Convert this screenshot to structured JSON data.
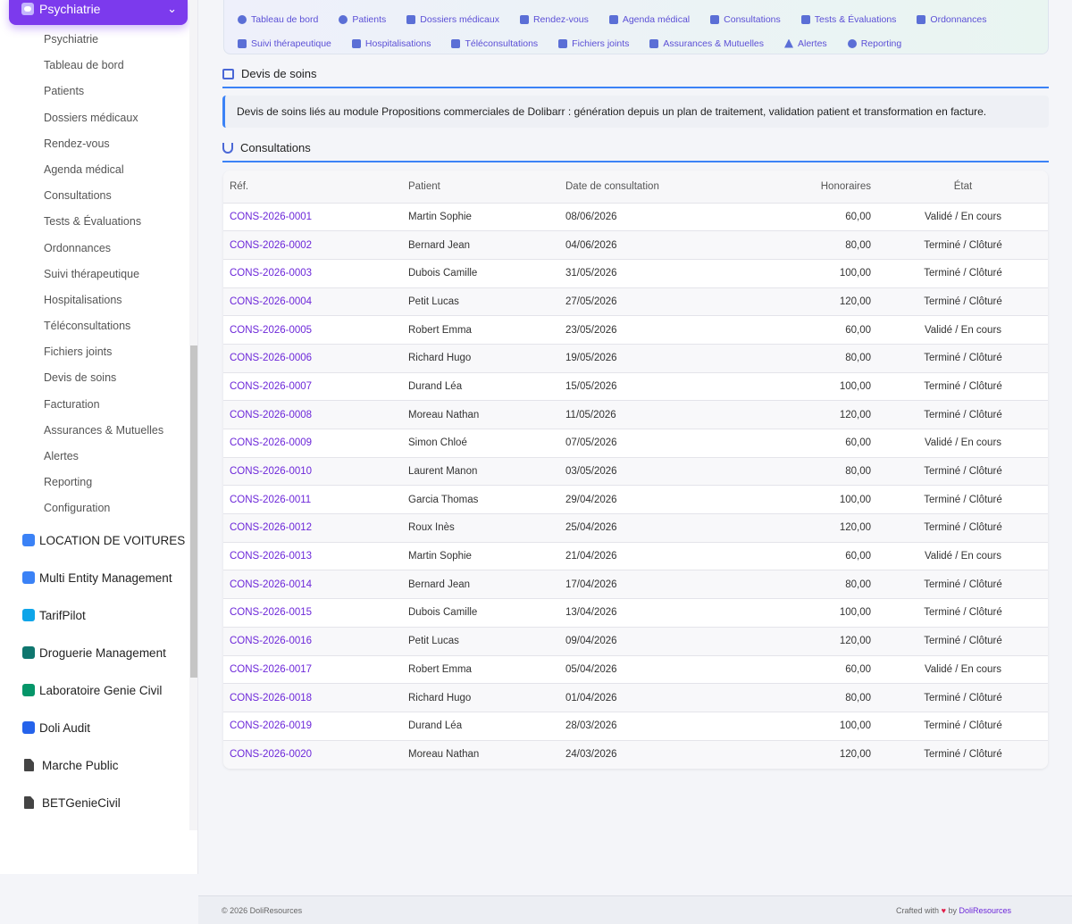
{
  "sidebar": {
    "active_title": "Psychiatrie",
    "sub_items": [
      "Psychiatrie",
      "Tableau de bord",
      "Patients",
      "Dossiers médicaux",
      "Rendez-vous",
      "Agenda médical",
      "Consultations",
      "Tests & Évaluations",
      "Ordonnances",
      "Suivi thérapeutique",
      "Hospitalisations",
      "Téléconsultations",
      "Fichiers joints",
      "Devis de soins",
      "Facturation",
      "Assurances & Mutuelles",
      "Alertes",
      "Reporting",
      "Configuration"
    ],
    "modules": [
      {
        "label": "LOCATION DE VOITURES",
        "color": "#3b82f6"
      },
      {
        "label": "Multi Entity Management",
        "color": "#3b82f6"
      },
      {
        "label": "TarifPilot",
        "color": "#0ea5e9"
      },
      {
        "label": "Droguerie Management",
        "color": "#0f766e"
      },
      {
        "label": "Laboratoire Genie Civil",
        "color": "#059669"
      },
      {
        "label": "Doli Audit",
        "color": "#2563eb"
      },
      {
        "label": "Marche Public",
        "color": "#444444"
      },
      {
        "label": "BETGenieCivil",
        "color": "#444444"
      }
    ]
  },
  "topnav": {
    "row1": [
      "Tableau de bord",
      "Patients",
      "Dossiers médicaux",
      "Rendez-vous",
      "Agenda médical",
      "Consultations",
      "Tests & Évaluations",
      "Ordonnances"
    ],
    "row2": [
      "Suivi thérapeutique",
      "Hospitalisations",
      "Téléconsultations",
      "Fichiers joints",
      "Assurances & Mutuelles",
      "Alertes",
      "Reporting"
    ]
  },
  "devis": {
    "title": "Devis de soins",
    "info": "Devis de soins liés au module Propositions commerciales de Dolibarr : génération depuis un plan de traitement, validation patient et transformation en facture."
  },
  "consultations": {
    "title": "Consultations",
    "headers": {
      "ref": "Réf.",
      "patient": "Patient",
      "date": "Date de consultation",
      "honoraires": "Honoraires",
      "etat": "État"
    },
    "rows": [
      [
        "CONS-2026-0001",
        "Martin Sophie",
        "08/06/2026",
        "60,00",
        "Validé / En cours"
      ],
      [
        "CONS-2026-0002",
        "Bernard Jean",
        "04/06/2026",
        "80,00",
        "Terminé / Clôturé"
      ],
      [
        "CONS-2026-0003",
        "Dubois Camille",
        "31/05/2026",
        "100,00",
        "Terminé / Clôturé"
      ],
      [
        "CONS-2026-0004",
        "Petit Lucas",
        "27/05/2026",
        "120,00",
        "Terminé / Clôturé"
      ],
      [
        "CONS-2026-0005",
        "Robert Emma",
        "23/05/2026",
        "60,00",
        "Validé / En cours"
      ],
      [
        "CONS-2026-0006",
        "Richard Hugo",
        "19/05/2026",
        "80,00",
        "Terminé / Clôturé"
      ],
      [
        "CONS-2026-0007",
        "Durand Léa",
        "15/05/2026",
        "100,00",
        "Terminé / Clôturé"
      ],
      [
        "CONS-2026-0008",
        "Moreau Nathan",
        "11/05/2026",
        "120,00",
        "Terminé / Clôturé"
      ],
      [
        "CONS-2026-0009",
        "Simon Chloé",
        "07/05/2026",
        "60,00",
        "Validé / En cours"
      ],
      [
        "CONS-2026-0010",
        "Laurent Manon",
        "03/05/2026",
        "80,00",
        "Terminé / Clôturé"
      ],
      [
        "CONS-2026-0011",
        "Garcia Thomas",
        "29/04/2026",
        "100,00",
        "Terminé / Clôturé"
      ],
      [
        "CONS-2026-0012",
        "Roux Inès",
        "25/04/2026",
        "120,00",
        "Terminé / Clôturé"
      ],
      [
        "CONS-2026-0013",
        "Martin Sophie",
        "21/04/2026",
        "60,00",
        "Validé / En cours"
      ],
      [
        "CONS-2026-0014",
        "Bernard Jean",
        "17/04/2026",
        "80,00",
        "Terminé / Clôturé"
      ],
      [
        "CONS-2026-0015",
        "Dubois Camille",
        "13/04/2026",
        "100,00",
        "Terminé / Clôturé"
      ],
      [
        "CONS-2026-0016",
        "Petit Lucas",
        "09/04/2026",
        "120,00",
        "Terminé / Clôturé"
      ],
      [
        "CONS-2026-0017",
        "Robert Emma",
        "05/04/2026",
        "60,00",
        "Validé / En cours"
      ],
      [
        "CONS-2026-0018",
        "Richard Hugo",
        "01/04/2026",
        "80,00",
        "Terminé / Clôturé"
      ],
      [
        "CONS-2026-0019",
        "Durand Léa",
        "28/03/2026",
        "100,00",
        "Terminé / Clôturé"
      ],
      [
        "CONS-2026-0020",
        "Moreau Nathan",
        "24/03/2026",
        "120,00",
        "Terminé / Clôturé"
      ]
    ]
  },
  "footer": {
    "copyright": "© 2026 DoliResources",
    "crafted": "Crafted with",
    "by": "by",
    "brand": "DoliResources"
  }
}
